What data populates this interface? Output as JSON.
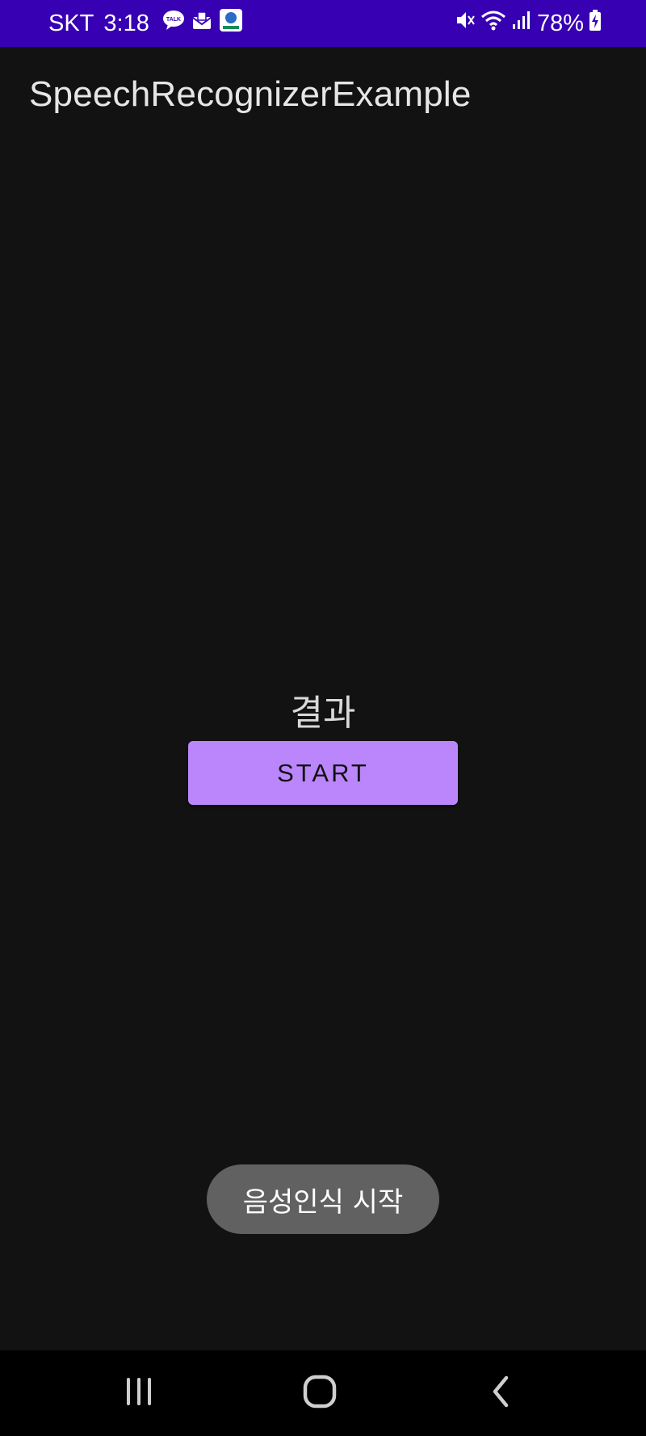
{
  "status_bar": {
    "carrier": "SKT",
    "time": "3:18",
    "left_icons": [
      "talk-icon",
      "mail-icon",
      "app-badge-icon"
    ],
    "right_icons": [
      "mute-icon",
      "wifi-icon",
      "signal-icon",
      "battery-charging-icon"
    ],
    "battery": "78%",
    "background_color": "#3700b3"
  },
  "app_bar": {
    "title": "SpeechRecognizerExample"
  },
  "main": {
    "result_label": "결과",
    "start_button_label": "START",
    "accent_color": "#bb86fc"
  },
  "toast": {
    "message": "음성인식 시작"
  },
  "nav_bar": {
    "buttons": [
      "recent-apps-icon",
      "home-icon",
      "back-icon"
    ]
  }
}
